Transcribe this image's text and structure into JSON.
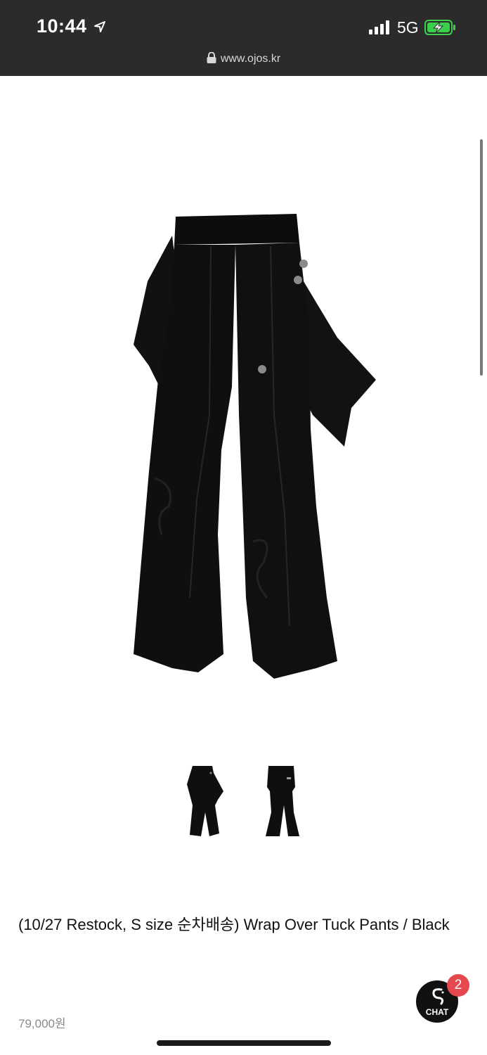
{
  "status_bar": {
    "time": "10:44",
    "network": "5G",
    "icons": [
      "location-arrow-icon",
      "signal-bars-icon",
      "battery-charging-icon"
    ]
  },
  "browser": {
    "url": "www.ojos.kr",
    "lock_icon": "lock-icon"
  },
  "product": {
    "title": "(10/27 Restock, S size 순차배송) Wrap Over Tuck Pants / Black",
    "price": "79,000원",
    "main_image": "black wrap-over tuck pants",
    "thumbnails": [
      "front view thumbnail",
      "back view thumbnail"
    ]
  },
  "chat": {
    "label": "CHAT",
    "badge_count": "2"
  },
  "colors": {
    "status_bar_bg": "#2b2b2b",
    "badge": "#e5484d",
    "price_text": "#8a8a8a"
  }
}
